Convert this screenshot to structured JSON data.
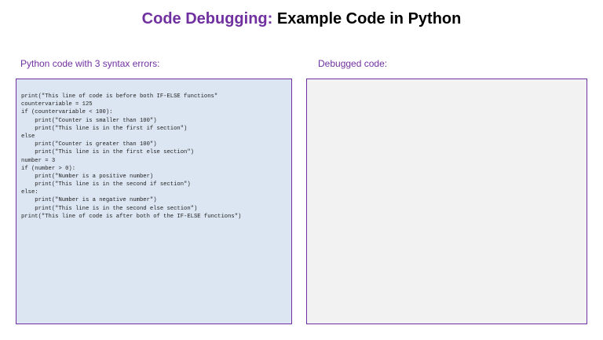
{
  "title": {
    "accent": "Code Debugging:",
    "rest": "Example Code in Python"
  },
  "left_panel": {
    "label": "Python code with 3 syntax errors:",
    "code_lines": [
      "print(\"This line of code is before both IF-ELSE functions\"",
      "countervariable = 125",
      "if (countervariable < 100):",
      "    print(\"Counter is smaller than 100\")",
      "    print(\"This line is in the first if section\")",
      "else",
      "    print(\"Counter is greater than 100\")",
      "    print(\"This line is in the first else section\")",
      "number = 3",
      "if (number > 0):",
      "    print(\"Number is a positive number)",
      "    print(\"This line is in the second if section\")",
      "else:",
      "    print(\"Number is a negative number\")",
      "    print(\"This line is in the second else section\")",
      "print(\"This line of code is after both of the IF-ELSE functions\")"
    ]
  },
  "right_panel": {
    "label": "Debugged code:"
  },
  "colors": {
    "accent": "#7030a0",
    "left_panel_bg": "#dce6f2",
    "right_panel_bg": "#f2f2f2"
  }
}
